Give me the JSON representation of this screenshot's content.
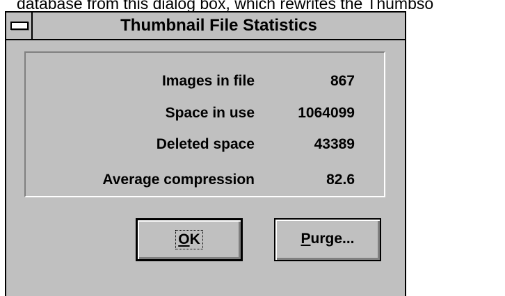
{
  "background_caption": "database from this dialog box, which rewrites the Thumbso",
  "dialog": {
    "title": "Thumbnail File Statistics",
    "system_menu_icon": "system-menu-icon"
  },
  "stats": [
    {
      "label": "Images in file",
      "value": "867"
    },
    {
      "label": "Space in use",
      "value": "1064099"
    },
    {
      "label": "Deleted space",
      "value": "43389"
    },
    {
      "label": "Average compression",
      "value": "82.6"
    }
  ],
  "buttons": {
    "ok": {
      "accel": "O",
      "rest": "K"
    },
    "purge": {
      "accel": "P",
      "rest": "urge..."
    }
  },
  "colors": {
    "dialog_face": "#c0c0c0",
    "shadow": "#808080",
    "highlight": "#ffffff"
  }
}
